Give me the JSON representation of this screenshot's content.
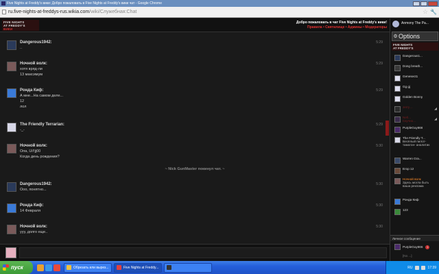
{
  "browser": {
    "window_title": "Five Nights at Freddy's вики: Добро пожаловать в Five Nights at Freddy's вики чат - Google Chrome",
    "url_host": "ru.five-nights-at-freddys-rus.wikia.com",
    "url_path": "/wiki/Служебная:Chat"
  },
  "header": {
    "logo_lines": [
      "FIVE NIGHTS",
      "AT FREDDY'S",
      "ВИКИ"
    ],
    "welcome": "Добро пожаловать в чат Five Nights at Freddy's вики!",
    "links": "Правила • Святилище • Админы • Модераторы"
  },
  "messages": [
    {
      "name": "Dangerous1942:",
      "lines": [
        ".."
      ],
      "time": "5:29"
    },
    {
      "name": "Ночной волк:",
      "lines": [
        "хотя вряд-ли",
        "13 максимум"
      ],
      "time": "5:29"
    },
    {
      "name": "Ронда Киф:",
      "lines": [
        "А мне...На самом деле...",
        "12",
        "лол"
      ],
      "time": "5:29"
    },
    {
      "name": "The Friendly Terrarian:",
      "lines": [
        "-_-"
      ],
      "time": "5:29"
    },
    {
      "name": "Ночной волк:",
      "lines": [
        "Опа, Ui!!jj00",
        "Когда день рождения?"
      ],
      "time": "5:30"
    },
    {
      "name": "Dangerous1942:",
      "lines": [
        "Ооо, понятно..."
      ],
      "time": "5:30"
    },
    {
      "name": "Ронда Киф:",
      "lines": [
        "14 Февраля"
      ],
      "time": "5:30"
    },
    {
      "name": "Ночной волк:",
      "lines": [
        "ууу, долго еще.."
      ],
      "time": "5:30"
    }
  ],
  "inline_alert": "~ Nick GunMaster покинул чат. ~",
  "sidebar": {
    "me": "Anmony The Pa...",
    "options": "Options",
    "room_lines": [
      "FIVE NIGHTS",
      "AT FREDDY'S"
    ],
    "users": [
      {
        "name": "Dangerous1...",
        "status": "",
        "style": "normal"
      },
      {
        "name": "Dong breath...",
        "status": "",
        "style": "normal"
      },
      {
        "name": "Genesect1",
        "status": "",
        "style": "normal"
      },
      {
        "name": "Gg gj",
        "status": "",
        "style": "normal"
      },
      {
        "name": "Golden Bonny",
        "status": "",
        "style": "normal"
      },
      {
        "name": "Jerry…",
        "status": "",
        "style": "away"
      },
      {
        "name": "Nell…",
        "status": "Cкучно…",
        "style": "away"
      },
      {
        "name": "PurpleGuy666",
        "status": "",
        "style": "normal"
      },
      {
        "name": "The Friendly T...",
        "status": "Весёлый пилот-тамогон- аналитик",
        "style": "normal"
      },
      {
        "name": "Warren Gra...",
        "status": "",
        "style": "normal"
      },
      {
        "name": "Егор 12",
        "status": "",
        "style": "normal"
      },
      {
        "name": "Ночной волк",
        "status": "Здесь могла быть ваша реклама",
        "style": "orange"
      },
      {
        "name": "Ронда Киф",
        "status": "",
        "style": "normal"
      },
      {
        "name": "123",
        "status": "",
        "style": "normal"
      }
    ],
    "pm_header": "Личное сообщение",
    "pm_user": "PurpleGuy666",
    "pm_badge": "1",
    "pm_user2": "[No ...]"
  },
  "taskbar": {
    "start": "пуск",
    "tasks": [
      "Обрезать или вырез...",
      "Five Nights at Freddy...",
      ""
    ],
    "lang": "RU",
    "clock": "17:39"
  },
  "colors": {
    "accent_red": "#e03030",
    "username_orange": "#ff8c28"
  }
}
